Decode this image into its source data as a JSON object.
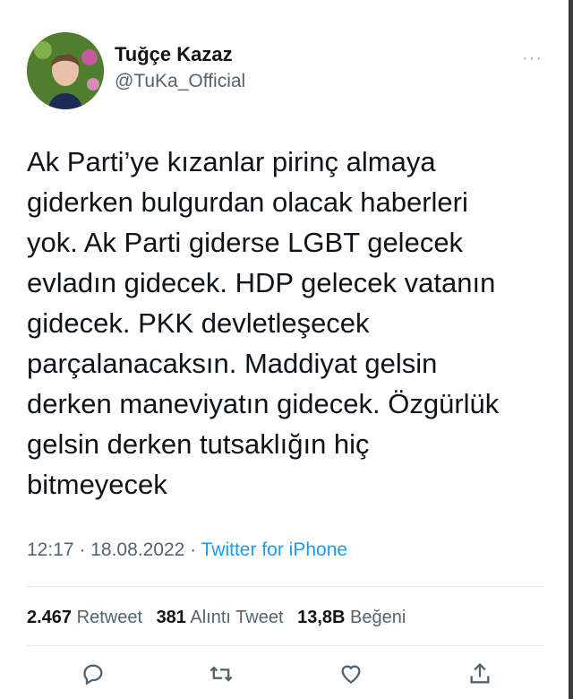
{
  "author": {
    "display_name": "Tuğçe Kazaz",
    "handle": "@TuKa_Official"
  },
  "more_label": "···",
  "tweet_text": "Ak Parti’ye kızanlar pirinç almaya\ngiderken bulgurdan olacak haberleri\nyok. Ak Parti giderse LGBT gelecek\nevladın gidecek. HDP gelecek vatanın\ngidecek. PKK devletleşecek\nparçalanacaksın. Maddiyat gelsin\nderken maneviyatın gidecek. Özgürlük\ngelsin derken tutsaklığın hiç\nbitmeyecek",
  "meta": {
    "time": "12:17",
    "sep1": " · ",
    "date": "18.08.2022",
    "sep2": " · ",
    "source": "Twitter for iPhone"
  },
  "stats": {
    "retweets_count": "2.467",
    "retweets_label": "Retweet",
    "quotes_count": "381",
    "quotes_label": "Alıntı Tweet",
    "likes_count": "13,8B",
    "likes_label": "Beğeni"
  },
  "icons": [
    "reply-icon",
    "retweet-icon",
    "like-icon",
    "share-icon"
  ],
  "colors": {
    "link": "#1d9bf0",
    "muted": "#536471",
    "text": "#0f1419"
  }
}
